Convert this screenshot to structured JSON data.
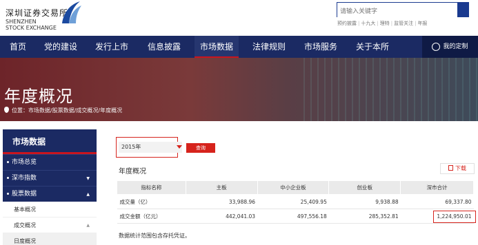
{
  "header": {
    "logo_cn": "深圳证券交易所",
    "logo_en_1": "SHENZHEN",
    "logo_en_2": "STOCK EXCHANGE",
    "search_placeholder": "请输入关键字",
    "hot_links": [
      "预约披露",
      "十九大",
      "理特",
      "监管关注",
      "年报"
    ]
  },
  "nav": {
    "items": [
      "首页",
      "党的建设",
      "发行上市",
      "信息披露",
      "市场数据",
      "法律规则",
      "市场服务",
      "关于本所"
    ],
    "active": "市场数据",
    "custom": "我的定制"
  },
  "banner": {
    "title": "年度概况",
    "breadcrumb": "位置：市场数据/股票数据/成交概况/年度概况"
  },
  "sidebar": {
    "title": "市场数据",
    "items": [
      "市场总览",
      "深市指数",
      "股票数据"
    ],
    "sub_items": [
      "基本概况",
      "成交概况",
      "日度概况"
    ]
  },
  "main": {
    "year": "2015年",
    "query_label": "查询",
    "section_title": "年度概况",
    "download_label": "下载",
    "columns": [
      "指标名称",
      "主板",
      "中小企业板",
      "创业板",
      "深市合计"
    ],
    "rows": [
      [
        "成交量（亿）",
        "33,988.96",
        "25,409.95",
        "9,938.88",
        "69,337.80"
      ],
      [
        "成交金额（亿元）",
        "442,041.03",
        "497,556.18",
        "285,352.81",
        "1,224,950.01"
      ]
    ],
    "footnote": "数据统计范围包含存托凭证。"
  },
  "colors": {
    "nav_bg": "#1b2a63",
    "accent_red": "#d6231c"
  }
}
